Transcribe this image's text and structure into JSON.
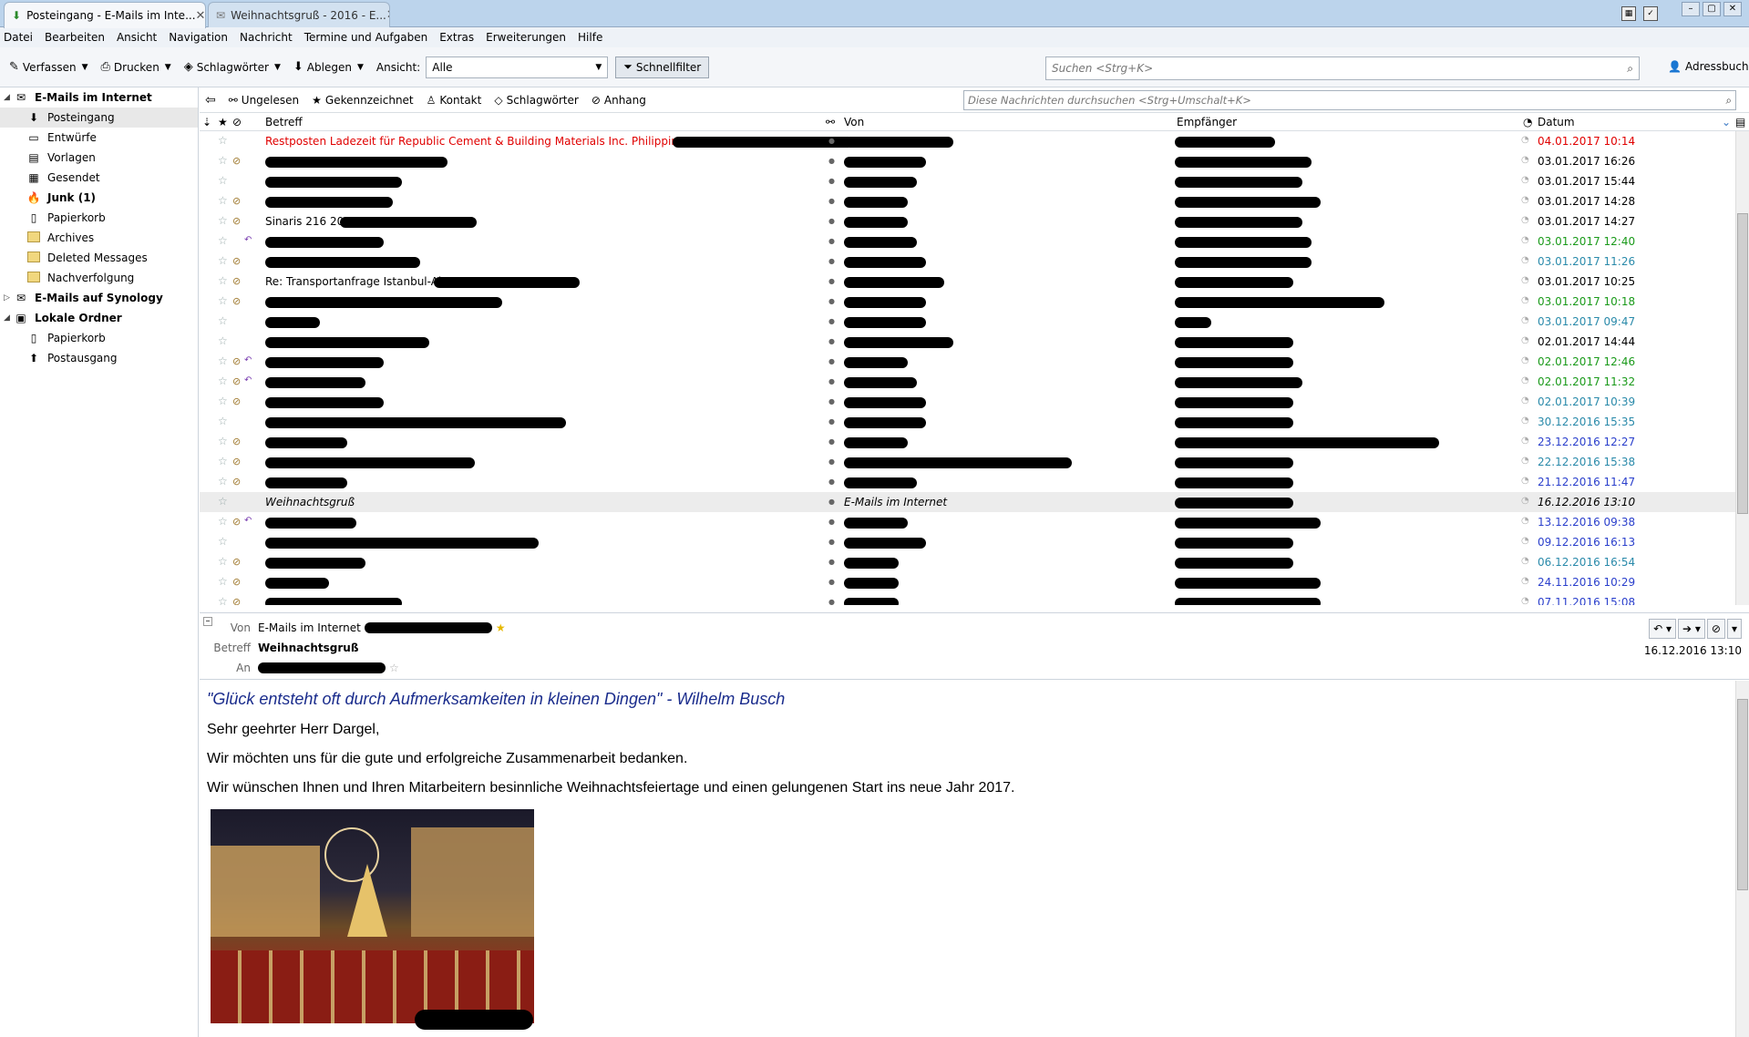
{
  "tabs": [
    {
      "label": "Posteingang - E-Mails im Inte..."
    },
    {
      "label": "Weihnachtsgruß - 2016 - E..."
    }
  ],
  "menu": [
    "Datei",
    "Bearbeiten",
    "Ansicht",
    "Navigation",
    "Nachricht",
    "Termine und Aufgaben",
    "Extras",
    "Erweiterungen",
    "Hilfe"
  ],
  "toolbar": {
    "compose": "Verfassen",
    "print": "Drucken",
    "tags": "Schlagwörter",
    "file": "Ablegen",
    "view_label": "Ansicht:",
    "view_value": "Alle",
    "quickfilter": "Schnellfilter",
    "search_placeholder": "Suchen <Strg+K>",
    "addressbook": "Adressbuch"
  },
  "sidebar": {
    "folders": [
      {
        "label": "E-Mails im Internet",
        "level": 0,
        "bold": true,
        "twisty": "◢",
        "icon": "account-icon"
      },
      {
        "label": "Posteingang",
        "level": 1,
        "selected": true,
        "icon": "inbox-icon"
      },
      {
        "label": "Entwürfe",
        "level": 1,
        "icon": "drafts-icon"
      },
      {
        "label": "Vorlagen",
        "level": 1,
        "icon": "templates-icon"
      },
      {
        "label": "Gesendet",
        "level": 1,
        "icon": "sent-icon"
      },
      {
        "label": "Junk (1)",
        "level": 1,
        "bold": true,
        "icon": "junk-icon"
      },
      {
        "label": "Papierkorb",
        "level": 1,
        "icon": "trash-icon"
      },
      {
        "label": "Archives",
        "level": 1,
        "icon": "folder-icon"
      },
      {
        "label": "Deleted Messages",
        "level": 1,
        "icon": "folder-icon"
      },
      {
        "label": "Nachverfolgung",
        "level": 1,
        "icon": "folder-icon"
      },
      {
        "label": "E-Mails auf Synology",
        "level": 0,
        "bold": true,
        "twisty": "▷",
        "icon": "account-icon"
      },
      {
        "label": "Lokale Ordner",
        "level": 0,
        "bold": true,
        "twisty": "◢",
        "icon": "local-folders-icon"
      },
      {
        "label": "Papierkorb",
        "level": 1,
        "icon": "trash-icon"
      },
      {
        "label": "Postausgang",
        "level": 1,
        "icon": "outbox-icon"
      }
    ]
  },
  "quickfilter": {
    "unread": "Ungelesen",
    "starred": "Gekennzeichnet",
    "contact": "Kontakt",
    "tags": "Schlagwörter",
    "attachment": "Anhang",
    "search_placeholder": "Diese Nachrichten durchsuchen <Strg+Umschalt+K>"
  },
  "columns": {
    "subject": "Betreff",
    "from": "Von",
    "to": "Empfänger",
    "date": "Datum"
  },
  "messages": [
    {
      "subject": "Restposten Ladezeit für Republic Cement & Building Materials Inc. Philippines",
      "from": "",
      "to": "",
      "date": "04.01.2017 10:14",
      "color": "#e00000",
      "att": false,
      "reply": false
    },
    {
      "subject": "",
      "from": "",
      "to": "",
      "date": "03.01.2017 16:26",
      "color": "#000000",
      "att": true,
      "reply": false
    },
    {
      "subject": "",
      "from": "",
      "to": "",
      "date": "03.01.2017 15:44",
      "color": "#000000",
      "att": false,
      "reply": false
    },
    {
      "subject": "",
      "from": "",
      "to": "",
      "date": "03.01.2017 14:28",
      "color": "#000000",
      "att": true,
      "reply": false
    },
    {
      "subject": "Sinaris 216 2016",
      "from": "",
      "to": "",
      "date": "03.01.2017 14:27",
      "color": "#000000",
      "att": true,
      "reply": false
    },
    {
      "subject": "",
      "from": "",
      "to": "",
      "date": "03.01.2017 12:40",
      "color": "#1a9a1a",
      "att": false,
      "reply": true
    },
    {
      "subject": "",
      "from": "",
      "to": "",
      "date": "03.01.2017 11:26",
      "color": "#2a8aaa",
      "att": true,
      "reply": false
    },
    {
      "subject": "Re: Transportanfrage Istanbul-Al...",
      "from": "",
      "to": "",
      "date": "03.01.2017 10:25",
      "color": "#000000",
      "att": true,
      "reply": false
    },
    {
      "subject": "",
      "from": "",
      "to": "",
      "date": "03.01.2017 10:18",
      "color": "#1a9a1a",
      "att": true,
      "reply": false
    },
    {
      "subject": "",
      "from": "",
      "to": "",
      "date": "03.01.2017 09:47",
      "color": "#2a8aaa",
      "att": false,
      "reply": false
    },
    {
      "subject": "",
      "from": "",
      "to": "",
      "date": "02.01.2017 14:44",
      "color": "#000000",
      "att": false,
      "reply": false
    },
    {
      "subject": "",
      "from": "",
      "to": "",
      "date": "02.01.2017 12:46",
      "color": "#1a9a1a",
      "att": true,
      "reply": true
    },
    {
      "subject": "",
      "from": "",
      "to": "",
      "date": "02.01.2017 11:32",
      "color": "#1a9a1a",
      "att": true,
      "reply": true
    },
    {
      "subject": "",
      "from": "",
      "to": "",
      "date": "02.01.2017 10:39",
      "color": "#2a8aaa",
      "att": true,
      "reply": false
    },
    {
      "subject": "",
      "from": "",
      "to": "",
      "date": "30.12.2016 15:35",
      "color": "#2a8aaa",
      "att": false,
      "reply": false
    },
    {
      "subject": "",
      "from": "",
      "to": "",
      "date": "23.12.2016 12:27",
      "color": "#2a3fcc",
      "att": true,
      "reply": false
    },
    {
      "subject": "",
      "from": "",
      "to": "",
      "date": "22.12.2016 15:38",
      "color": "#2a8aaa",
      "att": true,
      "reply": false
    },
    {
      "subject": "",
      "from": "",
      "to": "",
      "date": "21.12.2016 11:47",
      "color": "#2a3fcc",
      "att": true,
      "reply": false
    },
    {
      "subject": "Weihnachtsgruß",
      "from": "E-Mails im Internet",
      "to": "",
      "date": "16.12.2016 13:10",
      "color": "#000000",
      "att": false,
      "reply": false,
      "selected": true
    },
    {
      "subject": "",
      "from": "",
      "to": "",
      "date": "13.12.2016 09:38",
      "color": "#2a3fcc",
      "att": true,
      "reply": true
    },
    {
      "subject": "",
      "from": "",
      "to": "",
      "date": "09.12.2016 16:13",
      "color": "#2a3fcc",
      "att": false,
      "reply": false
    },
    {
      "subject": "",
      "from": "",
      "to": "",
      "date": "06.12.2016 16:54",
      "color": "#2a8aaa",
      "att": true,
      "reply": false
    },
    {
      "subject": "",
      "from": "",
      "to": "",
      "date": "24.11.2016 10:29",
      "color": "#2a3fcc",
      "att": true,
      "reply": false
    },
    {
      "subject": "",
      "from": "",
      "to": "",
      "date": "07.11.2016 15:08",
      "color": "#2a3fcc",
      "att": true,
      "reply": false
    }
  ],
  "header": {
    "from_label": "Von",
    "from_value": "E-Mails im Internet",
    "subject_label": "Betreff",
    "subject_value": "Weihnachtsgruß",
    "to_label": "An",
    "date": "16.12.2016 13:10"
  },
  "body": {
    "quote": "\"Glück entsteht oft durch Aufmerksamkeiten in kleinen Dingen\" - Wilhelm Busch",
    "greeting": "Sehr geehrter Herr Dargel,",
    "p1": "Wir möchten uns für die gute und erfolgreiche Zusammenarbeit bedanken.",
    "p2": "Wir wünschen Ihnen und Ihren Mitarbeitern besinnliche Weihnachtsfeiertage und einen gelungenen Start ins neue Jahr 2017."
  }
}
